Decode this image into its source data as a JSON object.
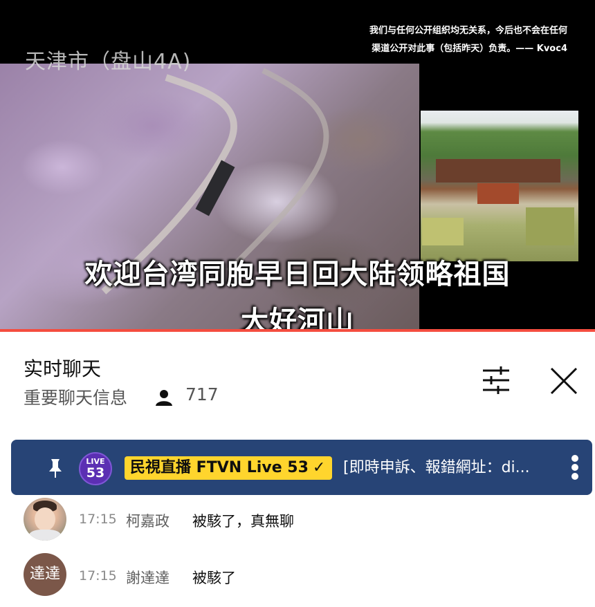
{
  "video": {
    "location_title": "天津市（盘山4A)",
    "disclaimer_line1": "我们与任何公开组织均无关系，今后也不会在任何",
    "disclaimer_line2": "渠道公开对此事（包括昨天）负责。—— Kvoc4",
    "subtitle_line1": "欢迎台湾同胞早日回大陆领略祖国",
    "subtitle_line2": "大好河山",
    "progress_color": "#f44d3f"
  },
  "chat": {
    "title": "实时聊天",
    "mode": "重要聊天信息",
    "viewer_count": "717",
    "icons": {
      "viewer": "person-icon",
      "filter": "sliders-icon",
      "close": "close-icon"
    }
  },
  "pinned": {
    "background_color": "#274476",
    "badge_top": "LIVE",
    "badge_number": "53",
    "author": "民視直播 FTVN Live 53",
    "check": "✓",
    "message": "[即時申訴、報錯網址：di...",
    "icons": {
      "pin": "pin-icon",
      "more": "more-vertical-icon"
    }
  },
  "messages": [
    {
      "time": "17:15",
      "author": "柯嘉政",
      "text": "被駭了，真無聊",
      "avatar": "photo"
    },
    {
      "time": "17:15",
      "author": "謝達達",
      "text": "被駭了",
      "avatar": "text",
      "avatar_text": "達達",
      "avatar_color": "#7b5749"
    }
  ]
}
